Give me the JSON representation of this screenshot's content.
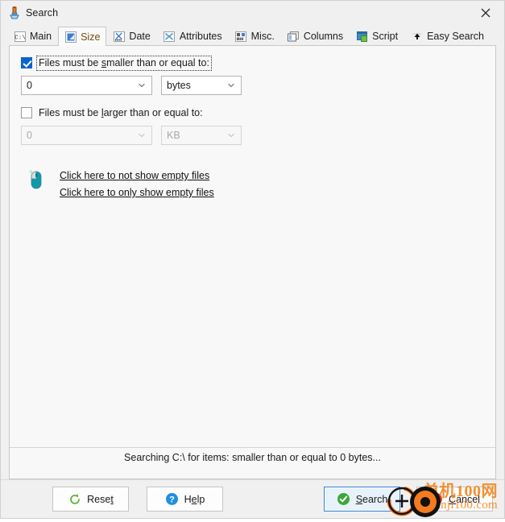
{
  "window": {
    "title": "Search",
    "title_icon": "search-tool-icon",
    "close_icon": "close-icon"
  },
  "tabs": [
    {
      "label": "Main",
      "icon": "console-cmd-icon",
      "active": false
    },
    {
      "label": "Size",
      "icon": "size-icon",
      "active": true
    },
    {
      "label": "Date",
      "icon": "date-chart-icon",
      "active": false
    },
    {
      "label": "Attributes",
      "icon": "attributes-icon",
      "active": false
    },
    {
      "label": "Misc.",
      "icon": "misc-icon",
      "active": false
    },
    {
      "label": "Columns",
      "icon": "columns-icon",
      "active": false
    },
    {
      "label": "Script",
      "icon": "script-icon",
      "active": false
    },
    {
      "label": "Easy Search",
      "icon": "easy-search-icon",
      "active": false
    }
  ],
  "size_tab": {
    "smaller": {
      "checkbox_checked": true,
      "label_before": "Files must be ",
      "label_accel": "s",
      "label_after": "maller than or equal to:",
      "value": "0",
      "unit": "bytes",
      "value_placeholder": "0",
      "enabled": true
    },
    "larger": {
      "checkbox_checked": false,
      "label_before": "Files must be ",
      "label_accel": "l",
      "label_after": "arger than or equal to:",
      "value": "0",
      "unit": "KB",
      "value_placeholder": "0",
      "enabled": false
    },
    "hint_icon": "mouse-click-icon",
    "links": [
      "Click here to not show empty files",
      "Click here to only show empty files"
    ]
  },
  "status": {
    "text": "Searching C:\\ for items: smaller than or equal to 0 bytes..."
  },
  "buttons": {
    "reset": {
      "before": "Rese",
      "accel": "t",
      "after": "",
      "icon": "refresh-icon"
    },
    "help": {
      "before": "H",
      "accel": "e",
      "after": "lp",
      "icon": "question-icon"
    },
    "search": {
      "before": "",
      "accel": "S",
      "after": "earch",
      "icon": "check-circle-icon"
    },
    "cancel": {
      "before": "",
      "accel": "C",
      "after": "ancel",
      "icon": "cancel-icon"
    }
  },
  "watermark": {
    "line1": "单机100网",
    "line2": "danji100.com",
    "color": "#f08a24"
  },
  "colors": {
    "accent_blue": "#0b63ce",
    "tab_active_text": "#7a4a12",
    "primary_border": "#3b84d4",
    "green": "#49a51f",
    "cursor_orange": "#f47b20"
  }
}
